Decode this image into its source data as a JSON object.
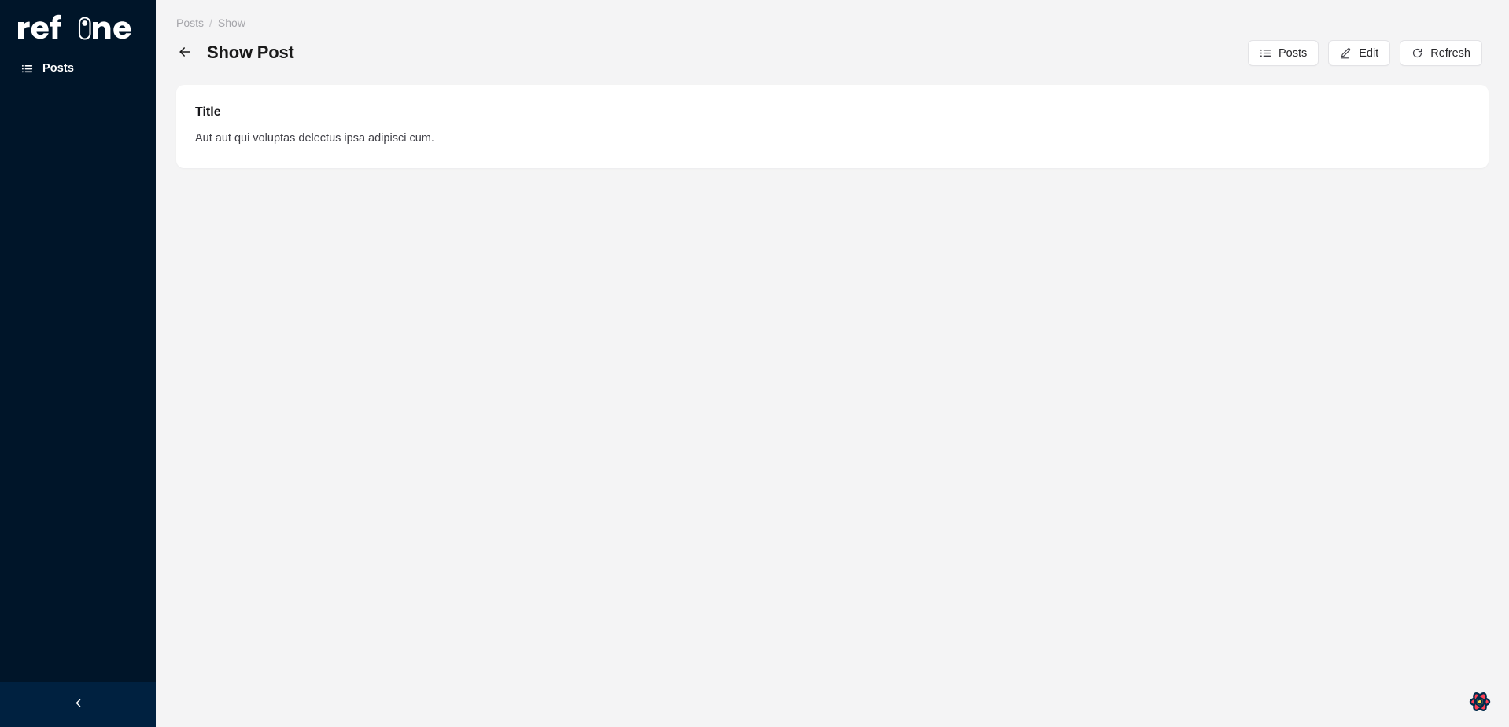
{
  "sidebar": {
    "logo_text": "refine",
    "items": [
      {
        "label": "Posts",
        "icon": "list-icon"
      }
    ],
    "collapse_label": "",
    "collapse_icon": "chevron-left-icon",
    "bg_color": "#001529",
    "collapse_bg_color": "#002140"
  },
  "breadcrumb": {
    "items": [
      "Posts",
      "Show"
    ],
    "separator": "/"
  },
  "header": {
    "back_icon": "arrow-left-icon",
    "title": "Show Post",
    "actions": [
      {
        "label": "Posts",
        "icon": "list-icon"
      },
      {
        "label": "Edit",
        "icon": "pencil-icon"
      },
      {
        "label": "Refresh",
        "icon": "refresh-icon"
      }
    ]
  },
  "card": {
    "fields": [
      {
        "label": "Title",
        "value": "Aut aut qui voluptas delectus ipsa adipisci cum."
      }
    ]
  },
  "devtools": {
    "icon": "react-query-flower-icon",
    "petal_color": "#FF4154",
    "center_color": "#FFD94C",
    "outline_color": "#002C4B"
  },
  "colors": {
    "page_bg": "#f4f4f5",
    "card_bg": "#ffffff",
    "text_primary": "#18181b",
    "text_muted": "#a6a6ab"
  }
}
